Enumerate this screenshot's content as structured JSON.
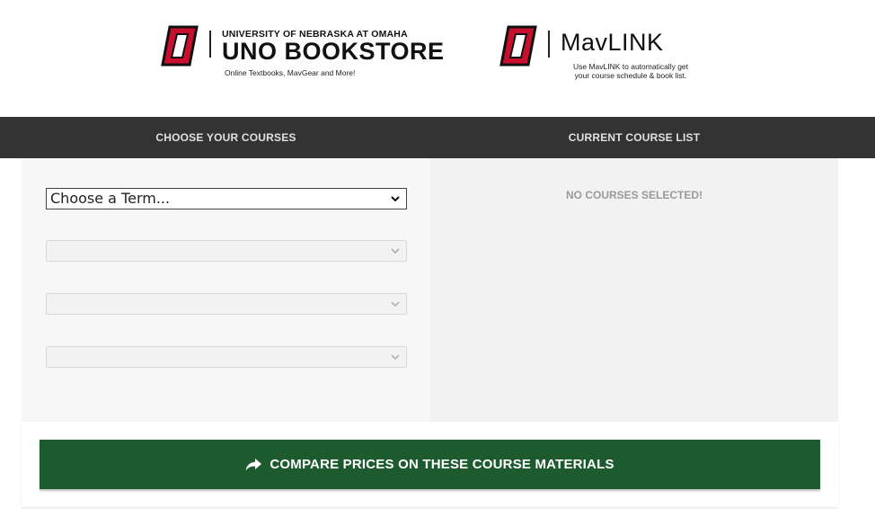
{
  "header": {
    "uno": {
      "small_title": "UNIVERSITY OF NEBRASKA AT OMAHA",
      "title": "UNO BOOKSTORE",
      "tagline": "Online Textbooks, MavGear and More!"
    },
    "mavlink": {
      "title": "MavLINK",
      "tagline_line1": "Use MavLINK to automatically get",
      "tagline_line2": "your course schedule & book list."
    },
    "brand_color": "#c8102e"
  },
  "tabs": {
    "choose": "CHOOSE YOUR COURSES",
    "current": "CURRENT COURSE LIST"
  },
  "course_selector": {
    "term_value": "Choose a Term..."
  },
  "course_list": {
    "empty_message": "NO COURSES SELECTED!"
  },
  "footer": {
    "compare_button": "COMPARE PRICES ON THESE COURSE MATERIALS",
    "button_color": "#1d5b2f",
    "button_icon": "share-arrow-icon"
  }
}
